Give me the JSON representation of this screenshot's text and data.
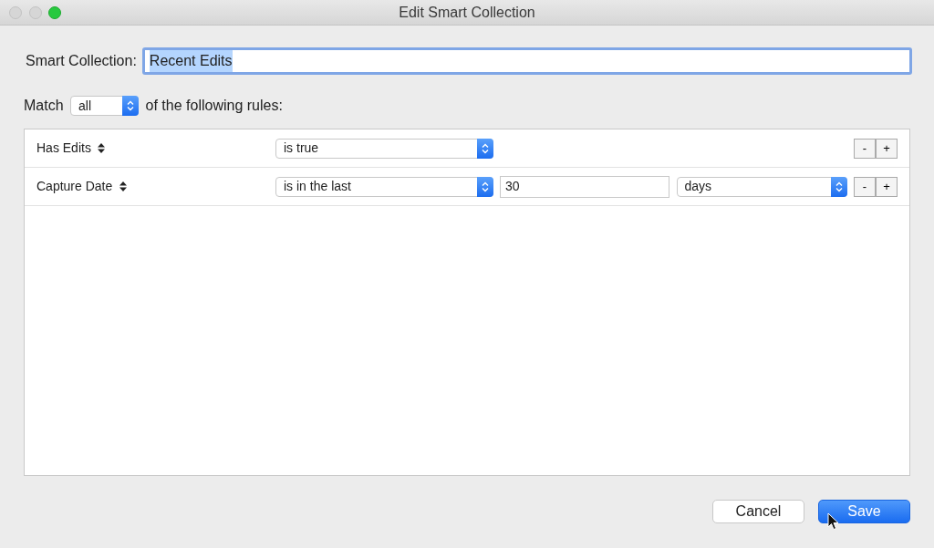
{
  "window": {
    "title": "Edit Smart Collection"
  },
  "name_field": {
    "label": "Smart Collection:",
    "value": "Recent Edits",
    "text_selected": true
  },
  "match": {
    "prefix": "Match",
    "value": "all",
    "suffix": "of the following rules:"
  },
  "rules": [
    {
      "kind": "boolean",
      "field": "Has Edits",
      "operator": "is true",
      "remove": "-",
      "add": "+"
    },
    {
      "kind": "date",
      "field": "Capture Date",
      "operator": "is in the last",
      "value": "30",
      "unit": "days",
      "remove": "-",
      "add": "+"
    }
  ],
  "buttons": [
    {
      "label": "Cancel",
      "primary": false
    },
    {
      "label": "Save",
      "primary": true
    }
  ]
}
